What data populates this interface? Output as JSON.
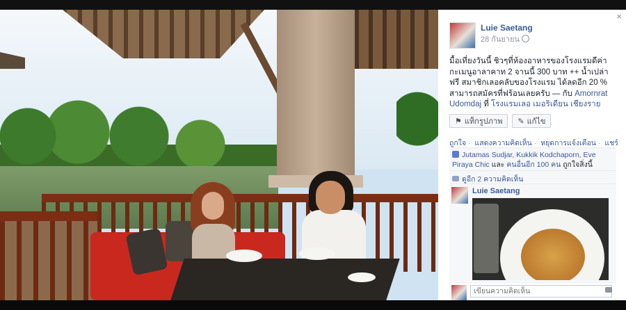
{
  "post": {
    "author": "Luie Saetang",
    "date": "28 กันยายน",
    "text_main": "มื้อเที่ยงวันนี้ ชิวๆที่ห้องอาหารของโรงแรมดีค่า กะเมนูอาลาคาท 2 จานนี้ 300 บาท ++ น้ำเปล่าฟรี สมาชิกเลอคลับของโรงแรม ได้ลดอีก 20 % สามารถสมัครที่ฟร้อนเลยครับ",
    "with_prefix": "— กับ",
    "with_name": "Amornrat Udomdaj",
    "at_prefix": "ที่",
    "place": "โรงแรมเลอ เมอริเดียน เชียงราย"
  },
  "buttons": {
    "tag_photo": "แท็กรูปภาพ",
    "edit": "แก้ไข"
  },
  "actions": {
    "like": "ถูกใจ",
    "comment": "แสดงความคิดเห็น",
    "stop_notify": "หยุดการแจ้งเตือน",
    "share": "แชร์"
  },
  "likes": {
    "names": "Jutamas Sudjar, Kukkik Kodchaporn, Eve Piraya Chic",
    "and_text": "และ",
    "others": "คนอื่นอีก 100 คน",
    "suffix": "ถูกใจสิ่งนี้"
  },
  "comments": {
    "view_more": "ดูอีก 2 ความคิดเห็น",
    "first_author": "Luie Saetang"
  },
  "write_comment": {
    "placeholder": "เขียนความคิดเห็น"
  },
  "window": {
    "close": "×"
  },
  "icons": {
    "close": "close-icon",
    "globe": "globe-icon",
    "tag": "tag-icon",
    "pencil": "pencil-icon",
    "thumb": "thumbs-up-icon",
    "comment": "comment-icon",
    "camera": "camera-icon"
  }
}
